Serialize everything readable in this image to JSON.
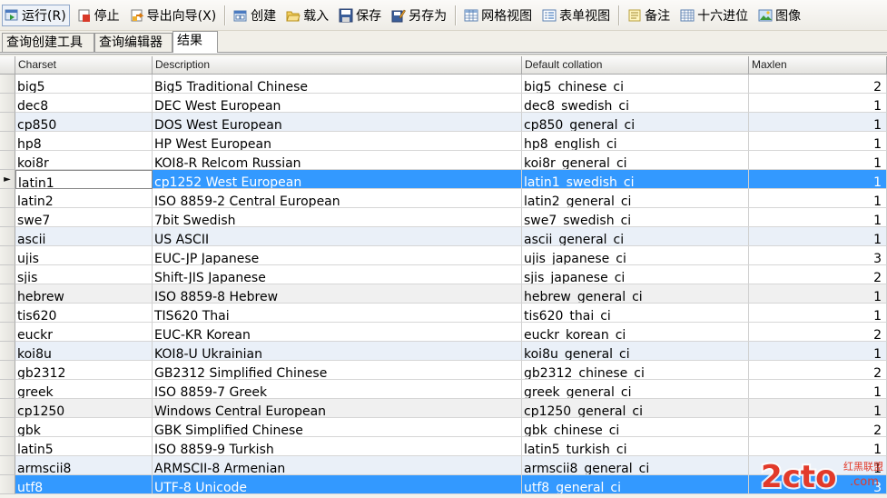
{
  "toolbar": {
    "buttons": [
      {
        "label": "运行(R)",
        "icon": "run-icon"
      },
      {
        "label": "停止",
        "icon": "stop-icon"
      },
      {
        "label": "导出向导(X)",
        "icon": "export-wizard-icon"
      },
      {
        "label": "创建",
        "icon": "create-icon"
      },
      {
        "label": "载入",
        "icon": "load-folder-icon"
      },
      {
        "label": "保存",
        "icon": "save-disk-icon"
      },
      {
        "label": "另存为",
        "icon": "save-as-icon"
      },
      {
        "label": "网格视图",
        "icon": "grid-view-icon"
      },
      {
        "label": "表单视图",
        "icon": "form-view-icon"
      },
      {
        "label": "备注",
        "icon": "memo-icon"
      },
      {
        "label": "十六进位",
        "icon": "hex-icon"
      },
      {
        "label": "图像",
        "icon": "image-icon"
      }
    ]
  },
  "tabs": [
    {
      "label": "查询创建工具",
      "selected": false
    },
    {
      "label": "查询编辑器",
      "selected": false
    },
    {
      "label": "结果",
      "selected": true
    }
  ],
  "grid": {
    "columns": [
      "Charset",
      "Description",
      "Default collation",
      "Maxlen"
    ],
    "rows": [
      [
        "big5",
        "Big5 Traditional Chinese",
        "big5_chinese_ci",
        "2"
      ],
      [
        "dec8",
        "DEC West European",
        "dec8_swedish_ci",
        "1"
      ],
      [
        "cp850",
        "DOS West European",
        "cp850_general_ci",
        "1"
      ],
      [
        "hp8",
        "HP West European",
        "hp8_english_ci",
        "1"
      ],
      [
        "koi8r",
        "KOI8-R Relcom Russian",
        "koi8r_general_ci",
        "1"
      ],
      [
        "latin1",
        "cp1252 West European",
        "latin1_swedish_ci",
        "1"
      ],
      [
        "latin2",
        "ISO 8859-2 Central European",
        "latin2_general_ci",
        "1"
      ],
      [
        "swe7",
        "7bit Swedish",
        "swe7_swedish_ci",
        "1"
      ],
      [
        "ascii",
        "US ASCII",
        "ascii_general_ci",
        "1"
      ],
      [
        "ujis",
        "EUC-JP Japanese",
        "ujis_japanese_ci",
        "3"
      ],
      [
        "sjis",
        "Shift-JIS Japanese",
        "sjis_japanese_ci",
        "2"
      ],
      [
        "hebrew",
        "ISO 8859-8 Hebrew",
        "hebrew_general_ci",
        "1"
      ],
      [
        "tis620",
        "TIS620 Thai",
        "tis620_thai_ci",
        "1"
      ],
      [
        "euckr",
        "EUC-KR Korean",
        "euckr_korean_ci",
        "2"
      ],
      [
        "koi8u",
        "KOI8-U Ukrainian",
        "koi8u_general_ci",
        "1"
      ],
      [
        "gb2312",
        "GB2312 Simplified Chinese",
        "gb2312_chinese_ci",
        "2"
      ],
      [
        "greek",
        "ISO 8859-7 Greek",
        "greek_general_ci",
        "1"
      ],
      [
        "cp1250",
        "Windows Central European",
        "cp1250_general_ci",
        "1"
      ],
      [
        "gbk",
        "GBK Simplified Chinese",
        "gbk_chinese_ci",
        "2"
      ],
      [
        "latin5",
        "ISO 8859-9 Turkish",
        "latin5_turkish_ci",
        "1"
      ],
      [
        "armscii8",
        "ARMSCII-8 Armenian",
        "armscii8_general_ci",
        "1"
      ],
      [
        "utf8",
        "UTF-8 Unicode",
        "utf8_general_ci",
        "3"
      ]
    ],
    "current_row_index": 5,
    "current_row_marker": "►",
    "selected_rows": [
      5,
      21
    ],
    "alt_rows": [
      2,
      8,
      14,
      20
    ],
    "grey_rows": [
      11,
      17
    ]
  },
  "watermark": {
    "text": "2cto",
    "subtext": "红黑联盟",
    "domain": ".com"
  },
  "colors": {
    "selection": "#3399ff",
    "alt_row": "#eaf0f8",
    "grey_row": "#f0f0f0"
  }
}
